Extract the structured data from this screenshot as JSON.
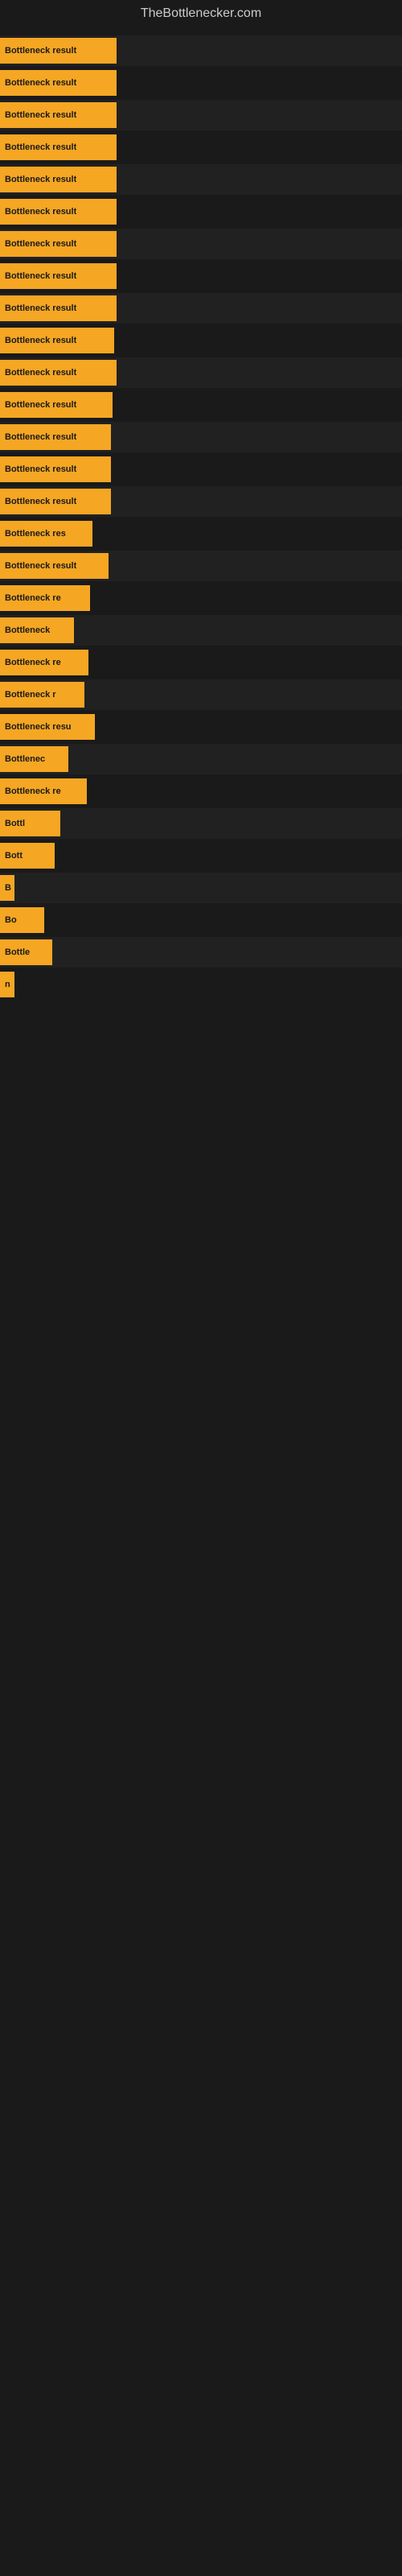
{
  "site": {
    "title": "TheBottlenecker.com"
  },
  "bars": [
    {
      "id": 1,
      "label": "Bottleneck result",
      "width_class": "bar-1"
    },
    {
      "id": 2,
      "label": "Bottleneck result",
      "width_class": "bar-2"
    },
    {
      "id": 3,
      "label": "Bottleneck result",
      "width_class": "bar-3"
    },
    {
      "id": 4,
      "label": "Bottleneck result",
      "width_class": "bar-4"
    },
    {
      "id": 5,
      "label": "Bottleneck result",
      "width_class": "bar-5"
    },
    {
      "id": 6,
      "label": "Bottleneck result",
      "width_class": "bar-6"
    },
    {
      "id": 7,
      "label": "Bottleneck result",
      "width_class": "bar-7"
    },
    {
      "id": 8,
      "label": "Bottleneck result",
      "width_class": "bar-8"
    },
    {
      "id": 9,
      "label": "Bottleneck result",
      "width_class": "bar-9"
    },
    {
      "id": 10,
      "label": "Bottleneck result",
      "width_class": "bar-10"
    },
    {
      "id": 11,
      "label": "Bottleneck result",
      "width_class": "bar-11"
    },
    {
      "id": 12,
      "label": "Bottleneck result",
      "width_class": "bar-12"
    },
    {
      "id": 13,
      "label": "Bottleneck result",
      "width_class": "bar-13"
    },
    {
      "id": 14,
      "label": "Bottleneck result",
      "width_class": "bar-14"
    },
    {
      "id": 15,
      "label": "Bottleneck result",
      "width_class": "bar-15"
    },
    {
      "id": 16,
      "label": "Bottleneck res",
      "width_class": "bar-16"
    },
    {
      "id": 17,
      "label": "Bottleneck result",
      "width_class": "bar-17"
    },
    {
      "id": 18,
      "label": "Bottleneck re",
      "width_class": "bar-18"
    },
    {
      "id": 19,
      "label": "Bottleneck",
      "width_class": "bar-19"
    },
    {
      "id": 20,
      "label": "Bottleneck re",
      "width_class": "bar-20"
    },
    {
      "id": 21,
      "label": "Bottleneck r",
      "width_class": "bar-21"
    },
    {
      "id": 22,
      "label": "Bottleneck resu",
      "width_class": "bar-22"
    },
    {
      "id": 23,
      "label": "Bottlenec",
      "width_class": "bar-23"
    },
    {
      "id": 24,
      "label": "Bottleneck re",
      "width_class": "bar-24"
    },
    {
      "id": 25,
      "label": "Bottl",
      "width_class": "bar-25"
    },
    {
      "id": 26,
      "label": "Bott",
      "width_class": "bar-26"
    },
    {
      "id": 27,
      "label": "B",
      "width_class": "bar-27"
    },
    {
      "id": 28,
      "label": "Bo",
      "width_class": "bar-28"
    },
    {
      "id": 29,
      "label": "Bottle",
      "width_class": "bar-29"
    },
    {
      "id": 30,
      "label": "n",
      "width_class": "bar-30"
    }
  ]
}
